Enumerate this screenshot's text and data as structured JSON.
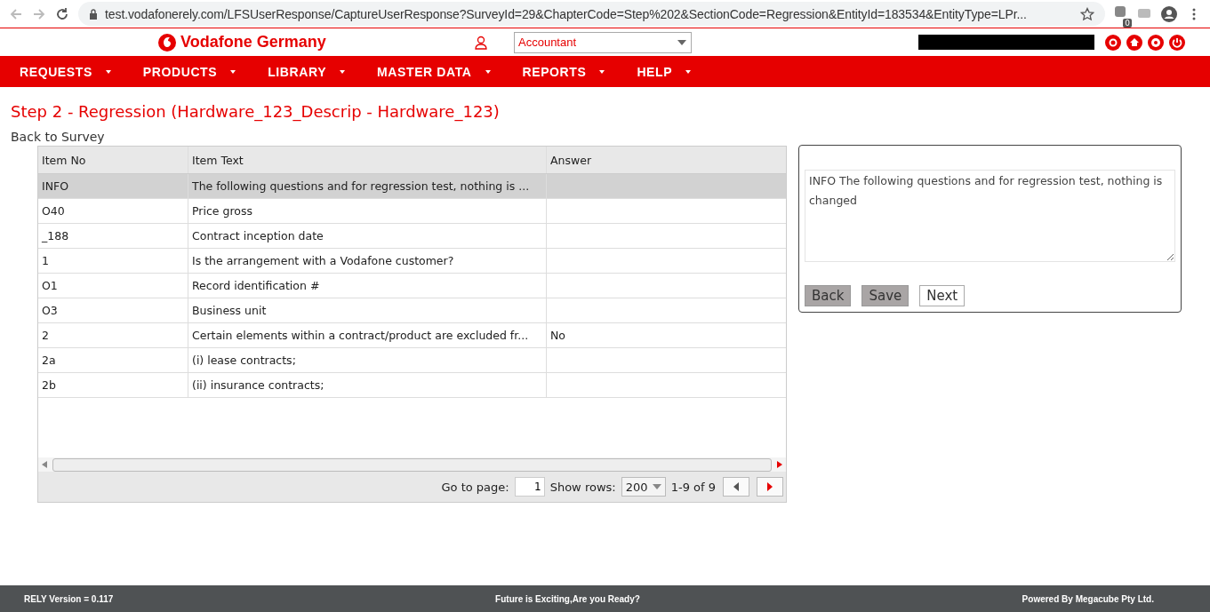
{
  "browser": {
    "url": "test.vodafonerely.com/LFSUserResponse/CaptureUserResponse?SurveyId=29&ChapterCode=Step%202&SectionCode=Regression&EntityId=183534&EntityType=LPr...",
    "extension_badge": "0"
  },
  "header": {
    "brand": "Vodafone Germany",
    "role": "Accountant"
  },
  "nav": [
    {
      "label": "REQUESTS"
    },
    {
      "label": "PRODUCTS"
    },
    {
      "label": "LIBRARY"
    },
    {
      "label": "MASTER DATA"
    },
    {
      "label": "REPORTS"
    },
    {
      "label": "HELP"
    }
  ],
  "page_title": "Step 2 - Regression (Hardware_123_Descrip - Hardware_123)",
  "back_link": "Back to Survey",
  "table": {
    "columns": [
      "Item No",
      "Item Text",
      "Answer"
    ],
    "rows": [
      {
        "cells": [
          "INFO",
          "The following questions and for regression test, nothing is ...",
          ""
        ],
        "selected": true
      },
      {
        "cells": [
          "O40",
          "Price gross",
          ""
        ],
        "selected": false
      },
      {
        "cells": [
          "_188",
          "Contract inception date",
          ""
        ],
        "selected": false
      },
      {
        "cells": [
          "1",
          "Is the arrangement with a Vodafone customer?",
          ""
        ],
        "selected": false
      },
      {
        "cells": [
          "O1",
          "Record identification #",
          ""
        ],
        "selected": false
      },
      {
        "cells": [
          "O3",
          "Business unit",
          ""
        ],
        "selected": false
      },
      {
        "cells": [
          "2",
          "Certain elements within a contract/product are excluded fr...",
          "No"
        ],
        "selected": false
      },
      {
        "cells": [
          "2a",
          "(i) lease contracts;",
          ""
        ],
        "selected": false
      },
      {
        "cells": [
          "2b",
          "(ii) insurance contracts;",
          ""
        ],
        "selected": false
      }
    ]
  },
  "pager": {
    "goto_label": "Go to page:",
    "page": "1",
    "rows_label": "Show rows:",
    "rows": "200",
    "range": "1-9 of 9"
  },
  "detail": {
    "text": "INFO The following questions and for regression test, nothing is changed",
    "buttons": [
      {
        "label": "Back",
        "disabled": true
      },
      {
        "label": "Save",
        "disabled": true
      },
      {
        "label": "Next",
        "disabled": false
      }
    ]
  },
  "footer": {
    "version": "RELY Version = 0.117",
    "slogan": "Future is Exciting,Are you Ready?",
    "powered": "Powered By Megacube Pty Ltd."
  }
}
